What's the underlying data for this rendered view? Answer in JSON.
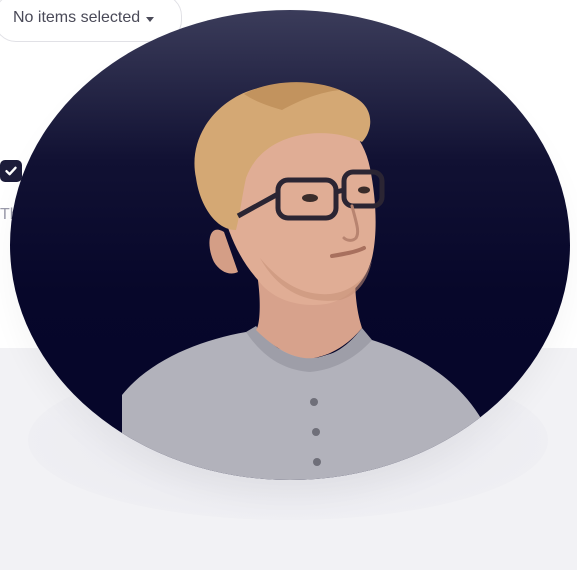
{
  "filter": {
    "dropdown_label": "No items selected"
  },
  "list": {
    "checkbox_checked": true,
    "row_text_partial": "Th"
  },
  "profile": {
    "avatar_alt": "Profile photo",
    "background_color": "#07072a"
  },
  "colors": {
    "checkbox": "#1c1c3a",
    "panel": "#ffffff",
    "page": "#f2f2f5"
  }
}
